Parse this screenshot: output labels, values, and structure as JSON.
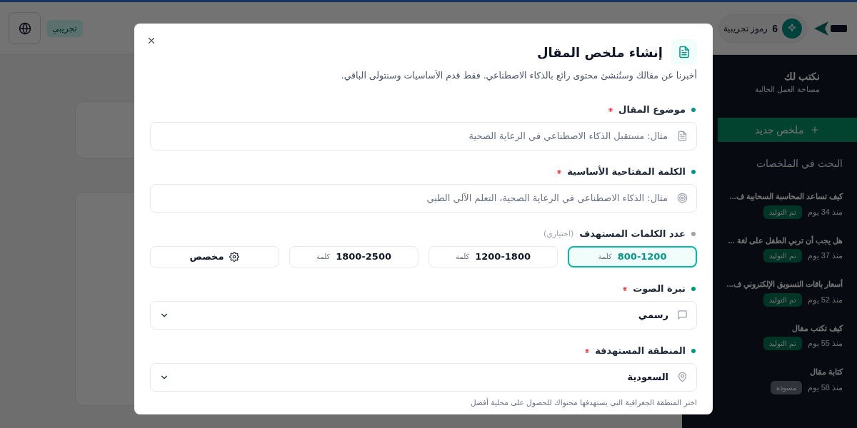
{
  "header": {
    "badge": "تجريبي",
    "tokens": {
      "count": "6",
      "label": "رموز تجريبية"
    }
  },
  "sidebar": {
    "workspace": {
      "title": "نكتب لك",
      "subtitle": "مساحة العمل الحالية"
    },
    "new_button": "ملخص جديد",
    "search": {
      "placeholder": "البحث في الملخصات"
    },
    "items": [
      {
        "title": "كيف تساعد المحاسبة السحابية ف...",
        "time": "منذ 34 يوم",
        "status": {
          "kind": "generated",
          "label": "تم التوليد"
        }
      },
      {
        "title": "هل يجب أن تربي الطفل على لغة ...",
        "time": "منذ 37 يوم",
        "status": {
          "kind": "generated",
          "label": "تم التوليد"
        }
      },
      {
        "title": "أسعار باقات التسويق الإلكتروني ف...",
        "time": "منذ 52 يوم",
        "status": {
          "kind": "generated",
          "label": "تم التوليد"
        }
      },
      {
        "title": "كيف تكتب مقال",
        "time": "منذ 55 يوم",
        "status": {
          "kind": "generated",
          "label": "تم التوليد"
        }
      },
      {
        "title": "كتابة مقال",
        "time": "منذ 58 يوم",
        "status": {
          "kind": "draft",
          "label": "مسودة"
        }
      }
    ]
  },
  "modal": {
    "title": "إنشاء ملخص المقال",
    "description": "أخبرنا عن مقالك وسنُنشئ محتوى رائع بالذكاء الاصطناعي. فقط قدم الأساسيات وسنتولى الباقي.",
    "fields": [
      {
        "kind": "text",
        "label": "موضوع المقال",
        "required": true,
        "placeholder": "مثال: مستقبل الذكاء الاصطناعي في الرعاية الصحية"
      },
      {
        "kind": "text",
        "label": "الكلمة المفتاحية الأساسية",
        "required": true,
        "placeholder": "مثال: الذكاء الاصطناعي في الرعاية الصحية، التعلم الآلي الطبي"
      },
      {
        "kind": "choices",
        "label": "عدد الكلمات المستهدف",
        "required": false,
        "optional_note": "(اختياري)",
        "options": [
          {
            "kind": "range",
            "value": "800-1200",
            "unit": "كلمة",
            "selected": true
          },
          {
            "kind": "range",
            "value": "1200-1800",
            "unit": "كلمة",
            "selected": false
          },
          {
            "kind": "range",
            "value": "1800-2500",
            "unit": "كلمة",
            "selected": false
          },
          {
            "kind": "custom",
            "value": "مخصص",
            "selected": false
          }
        ]
      },
      {
        "kind": "select",
        "label": "نبرة الصوت",
        "required": true,
        "value": "رسمي"
      },
      {
        "kind": "select",
        "label": "المنطقة المستهدفة",
        "required": true,
        "value": "السعودية",
        "hint": "اختر المنطقة الجغرافية التي يستهدفها محتواك للحصول على محلية أفضل"
      }
    ]
  }
}
